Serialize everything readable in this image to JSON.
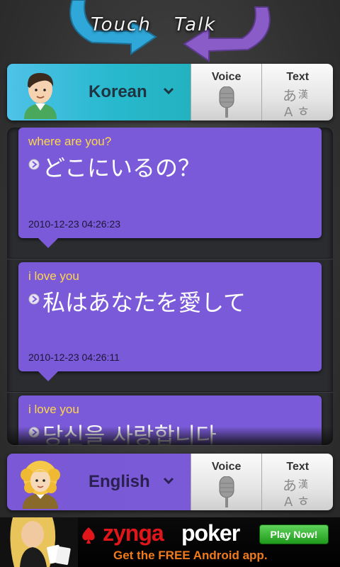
{
  "app": {
    "logo_word_1": "Touch",
    "logo_word_2": "Talk"
  },
  "source_bar": {
    "language": "Korean",
    "voice_label": "Voice",
    "text_label": "Text"
  },
  "target_bar": {
    "language": "English",
    "voice_label": "Voice",
    "text_label": "Text"
  },
  "messages": [
    {
      "source": "where are you?",
      "translation": "どこにいるの？",
      "timestamp": "2010-12-23 04:26:23"
    },
    {
      "source": "i love you",
      "translation": "私はあなたを愛して",
      "timestamp": "2010-12-23 04:26:11"
    },
    {
      "source": "i love you",
      "translation": "당신을 사랑합니다",
      "timestamp": ""
    }
  ],
  "ad": {
    "brand_part_1": "zynga",
    "brand_part_2": "poker",
    "tagline": "Get the FREE Android app.",
    "cta": "Play Now!"
  },
  "colors": {
    "bubble": "#7a5ad8",
    "source_text": "#ffd84a",
    "korean_bar": "#29b9cf",
    "english_bar": "#7b5ad8"
  }
}
